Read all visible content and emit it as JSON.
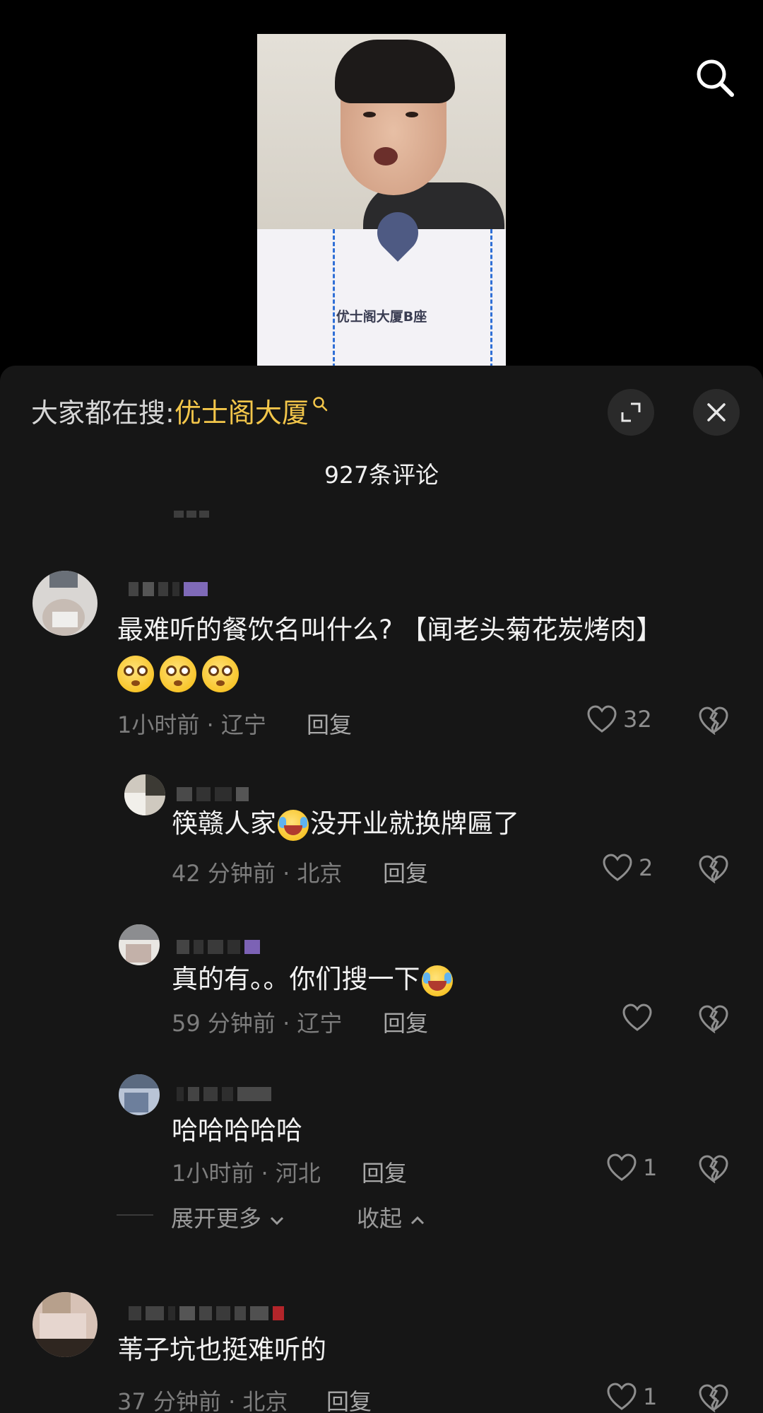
{
  "video": {
    "map_label": "优士阁大厦B座"
  },
  "sheet": {
    "search_prefix": "大家都在搜: ",
    "search_term": "优士阁大厦",
    "count_title": "927条评论"
  },
  "comments": [
    {
      "text": "最难听的餐饮名叫什么? 【闻老头菊花炭烤肉】",
      "meta": "1小时前 · 辽宁",
      "reply": "回复",
      "likes": "32"
    },
    {
      "text_a": "筷赣人家",
      "text_b": "没开业就换牌匾了",
      "meta": "42 分钟前 · 北京",
      "reply": "回复",
      "likes": "2"
    },
    {
      "text": "真的有。。你们搜一下",
      "meta": "59 分钟前 · 辽宁",
      "reply": "回复",
      "likes": ""
    },
    {
      "text": "哈哈哈哈哈",
      "meta": "1小时前 · 河北",
      "reply": "回复",
      "likes": "1"
    },
    {
      "text": "苇子坑也挺难听的",
      "meta": "37 分钟前 · 北京",
      "reply": "回复",
      "likes": "1"
    }
  ],
  "thread": {
    "expand_more": "展开更多",
    "collapse": "收起"
  },
  "icons": {
    "search": "search-icon",
    "expand": "expand-icon",
    "close": "close-icon",
    "like": "heart-icon",
    "dislike": "broken-heart-icon"
  }
}
